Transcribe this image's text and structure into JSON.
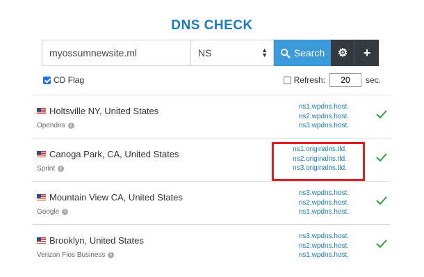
{
  "header": {
    "title": "DNS CHECK"
  },
  "search": {
    "domain_value": "myossumnewsite.ml",
    "record_type": "NS",
    "search_label": "Search"
  },
  "options": {
    "cd_flag_label": "CD Flag",
    "cd_flag_checked": true,
    "refresh_label": "Refresh:",
    "refresh_value": "20",
    "refresh_unit": "sec.",
    "refresh_checked": false
  },
  "colors": {
    "accent": "#1a7bbf",
    "button": "#3d9ad9",
    "dark": "#343a40",
    "ok": "#2e9e3e",
    "highlight": "#e02020"
  },
  "results": [
    {
      "location": "Holtsville NY, United States",
      "provider": "Opendns",
      "ns": [
        "ns1.wpdns.host.",
        "ns2.wpdns.host.",
        "ns3.wpdns.host."
      ],
      "status": "ok",
      "highlighted": false
    },
    {
      "location": "Canoga Park, CA, United States",
      "provider": "Sprint",
      "ns": [
        "ns1.originalns.tld.",
        "ns2.originalns.tld.",
        "ns3.originalns.tld."
      ],
      "status": "ok",
      "highlighted": true
    },
    {
      "location": "Mountain View CA, United States",
      "provider": "Google",
      "ns": [
        "ns3.wpdns.host.",
        "ns2.wpdns.host.",
        "ns1.wpdns.host."
      ],
      "status": "ok",
      "highlighted": false
    },
    {
      "location": "Brooklyn, United States",
      "provider": "Verizon Fios Business",
      "ns": [
        "ns3.wpdns.host.",
        "ns2.wpdns.host.",
        "ns1.wpdns.host."
      ],
      "status": "ok",
      "highlighted": false
    }
  ]
}
